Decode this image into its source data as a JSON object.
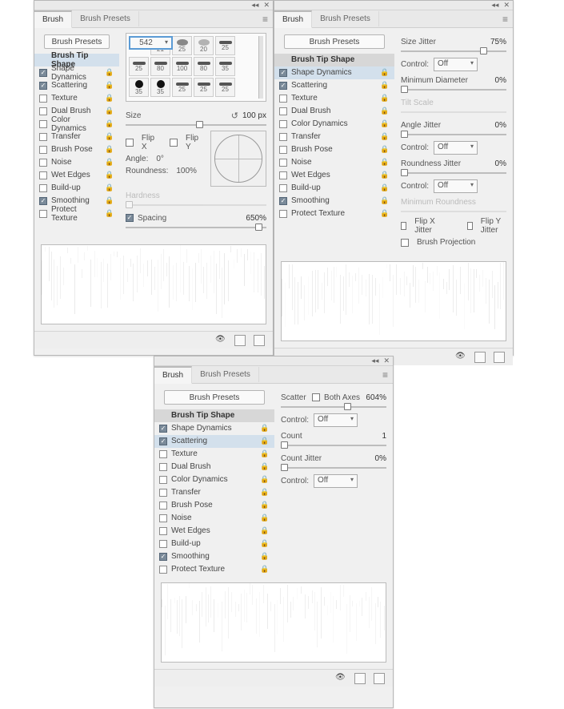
{
  "tabs": {
    "brush": "Brush",
    "presets": "Brush Presets"
  },
  "presetsBtn": "Brush Presets",
  "sidebarItemLabels": {
    "tipShape": "Brush Tip Shape",
    "shapeDynamics": "Shape Dynamics",
    "scattering": "Scattering",
    "texture": "Texture",
    "dualBrush": "Dual Brush",
    "colorDynamics": "Color Dynamics",
    "transfer": "Transfer",
    "brushPose": "Brush Pose",
    "noise": "Noise",
    "wetEdges": "Wet Edges",
    "buildUp": "Build-up",
    "smoothing": "Smoothing",
    "protectTexture": "Protect Texture"
  },
  "panel1": {
    "selected": "tipShape",
    "checked": {
      "shapeDynamics": true,
      "scattering": true,
      "smoothing": true
    },
    "brushes": [
      [
        "542",
        "21",
        "25",
        "20",
        "25"
      ],
      [
        "25",
        "80",
        "100",
        "80",
        "35"
      ],
      [
        "35",
        "35",
        "25",
        "25",
        "25"
      ]
    ],
    "brushesRow4": [
      "",
      "",
      "",
      "",
      ""
    ],
    "sizeLabel": "Size",
    "sizeValue": "100 px",
    "flipX": "Flip X",
    "flipY": "Flip Y",
    "angleLabel": "Angle:",
    "angleValue": "0°",
    "roundnessLabel": "Roundness:",
    "roundnessValue": "100%",
    "hardnessLabel": "Hardness",
    "spacingLabel": "Spacing",
    "spacingChecked": true,
    "spacingValue": "650%"
  },
  "panel2": {
    "selected": "shapeDynamics",
    "checked": {
      "shapeDynamics": true,
      "scattering": true,
      "smoothing": true
    },
    "sizeJitterLabel": "Size Jitter",
    "sizeJitterValue": "75%",
    "controlLabel": "Control:",
    "controlOff": "Off",
    "minDiamLabel": "Minimum Diameter",
    "minDiamValue": "0%",
    "tiltScaleLabel": "Tilt Scale",
    "angleJitterLabel": "Angle Jitter",
    "angleJitterValue": "0%",
    "roundJitterLabel": "Roundness Jitter",
    "roundJitterValue": "0%",
    "minRoundLabel": "Minimum Roundness",
    "flipXJitter": "Flip X Jitter",
    "flipYJitter": "Flip Y Jitter",
    "brushProjection": "Brush Projection"
  },
  "panel3": {
    "selected": "scattering",
    "checked": {
      "shapeDynamics": true,
      "scattering": true,
      "smoothing": true
    },
    "scatterLabel": "Scatter",
    "bothAxesLabel": "Both Axes",
    "scatterValue": "604%",
    "controlLabel": "Control:",
    "controlOff": "Off",
    "countLabel": "Count",
    "countValue": "1",
    "countJitterLabel": "Count Jitter",
    "countJitterValue": "0%"
  },
  "winControls": {
    "collapse": "◂◂",
    "close": "✕"
  }
}
